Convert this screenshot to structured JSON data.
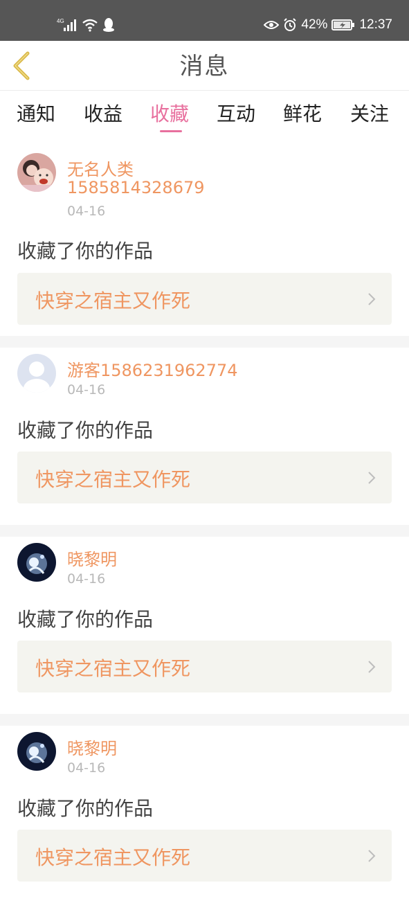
{
  "status_bar": {
    "network": "4G",
    "battery": "42%",
    "time": "12:37",
    "icons": [
      "signal-icon",
      "wifi-icon",
      "qq-icon",
      "eye-icon",
      "alarm-icon",
      "battery-icon"
    ]
  },
  "header": {
    "title": "消息"
  },
  "tabs": [
    {
      "label": "通知"
    },
    {
      "label": "收益"
    },
    {
      "label": "收藏",
      "active": true
    },
    {
      "label": "互动"
    },
    {
      "label": "鲜花"
    },
    {
      "label": "关注"
    }
  ],
  "messages": [
    {
      "name": "无名人类",
      "id": "1585814328679",
      "date": "04-16",
      "action": "收藏了你的作品",
      "book": "快穿之宿主又作死",
      "avatar": "photo-avatar"
    },
    {
      "name": "游客1586231962774",
      "date": "04-16",
      "action": "收藏了你的作品",
      "book": "快穿之宿主又作死",
      "avatar": "default-avatar"
    },
    {
      "name": "晓黎明",
      "date": "04-16",
      "action": "收藏了你的作品",
      "book": "快穿之宿主又作死",
      "avatar": "dark-avatar"
    },
    {
      "name": "晓黎明",
      "date": "04-16",
      "action": "收藏了你的作品",
      "book": "快穿之宿主又作死",
      "avatar": "dark-avatar"
    }
  ],
  "colors": {
    "accent": "#e8709e",
    "orange": "#ef9661",
    "statusbar": "#565656",
    "back_arrow": "#d9b84a"
  }
}
